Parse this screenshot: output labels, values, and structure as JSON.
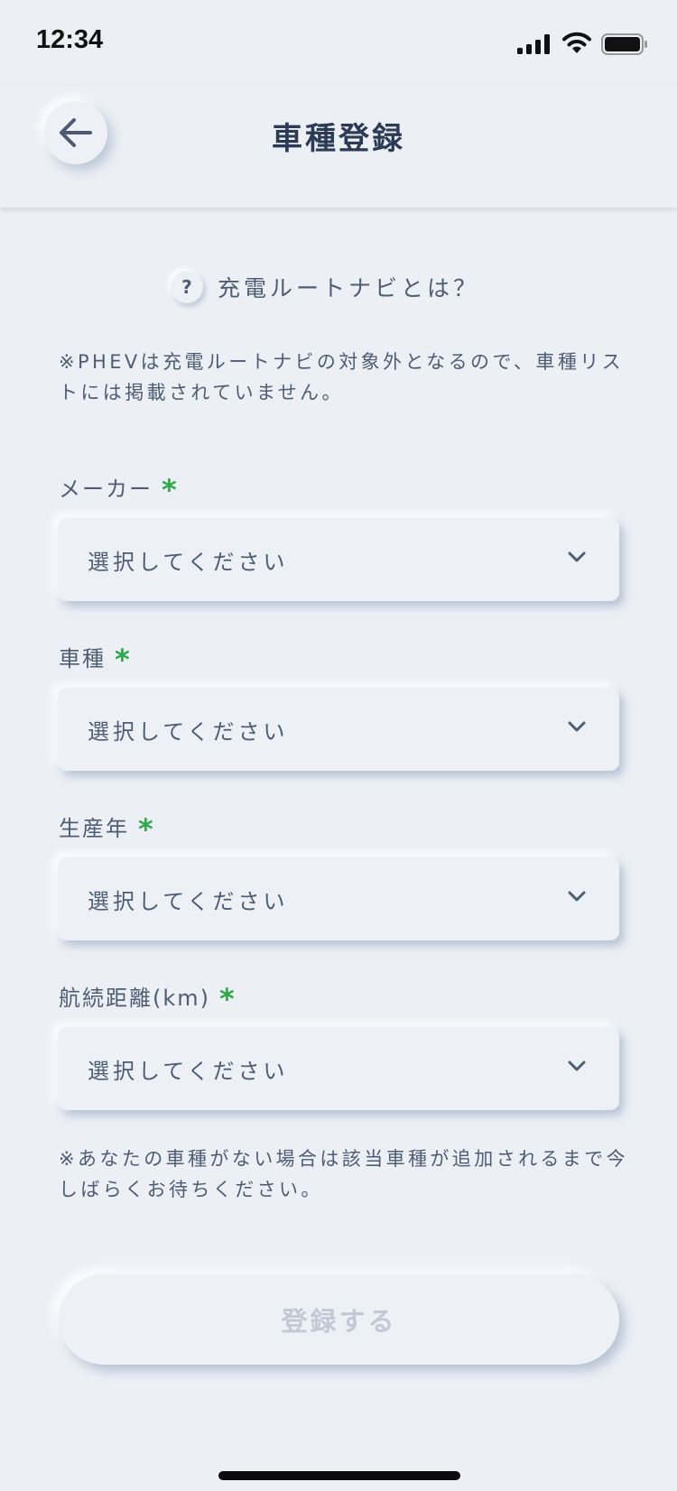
{
  "status": {
    "time": "12:34",
    "icons": [
      "signal-icon",
      "wifi-icon",
      "battery-icon"
    ]
  },
  "header": {
    "title": "車種登録",
    "back_icon": "arrow-left-icon"
  },
  "help": {
    "icon_symbol": "?",
    "label": "充電ルートナビとは？"
  },
  "notes": {
    "phev": "※PHEVは充電ルートナビの対象外となるので、車種リストには掲載されていません。",
    "missing": "※あなたの車種がない場合は該当車種が追加されるまで今しばらくお待ちください。"
  },
  "form": {
    "required_mark": "*",
    "fields": [
      {
        "label": "メーカー",
        "value": "選択してください"
      },
      {
        "label": "車種",
        "value": "選択してください"
      },
      {
        "label": "生産年",
        "value": "選択してください"
      },
      {
        "label": "航続距離(km)",
        "value": "選択してください"
      }
    ],
    "submit_label": "登録する"
  },
  "colors": {
    "background": "#ecf0f5",
    "text": "#4e5d73",
    "title": "#2c3b55",
    "required": "#2fa84a",
    "disabled_text": "#c2c9d4"
  }
}
